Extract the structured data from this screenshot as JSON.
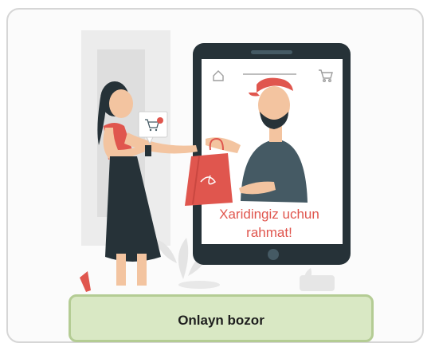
{
  "card": {
    "thanks_line1": "Xaridingiz uchun",
    "thanks_line2": "rahmat!",
    "caption": "Onlayn bozor"
  },
  "icons": [
    "home-icon",
    "cart-icon",
    "cart-bubble-icon"
  ],
  "colors": {
    "accent": "#e0564e",
    "caption_bg": "#d9e8c4",
    "caption_border": "#b4cc94",
    "device": "#263238"
  }
}
